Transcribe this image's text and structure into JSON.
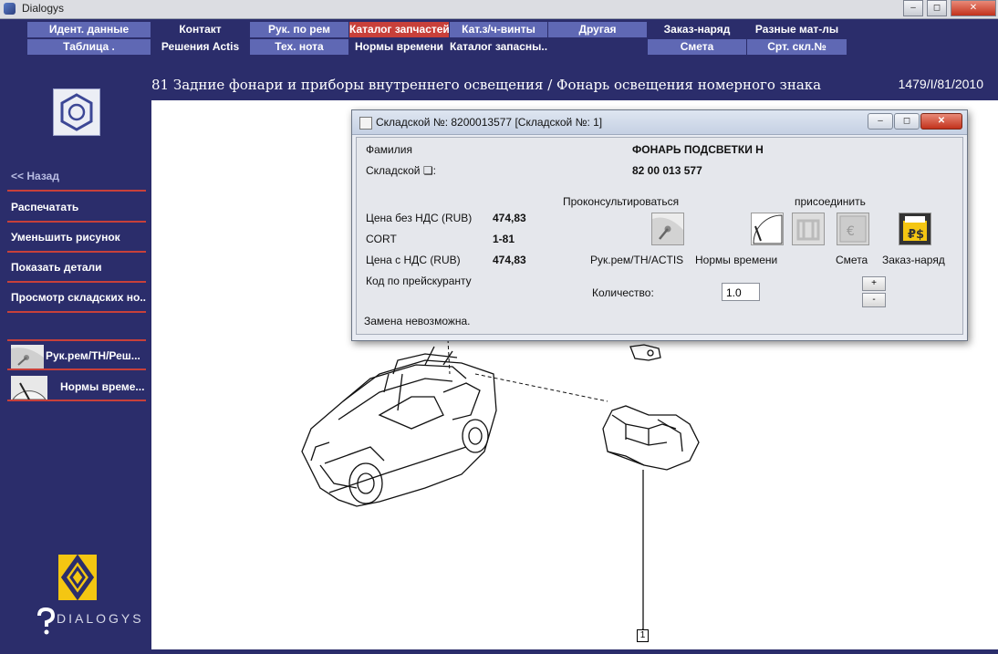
{
  "window": {
    "title": "Dialogys",
    "min": "–",
    "max": "◻",
    "close": "✕"
  },
  "menu": {
    "row1": [
      "Идент. данные",
      "Контакт",
      "Рук. по рем",
      "Каталог запчастей",
      "Кат.з/ч-винты",
      "Другая",
      "Заказ-наряд",
      "Разные мат-лы"
    ],
    "row2": [
      "Таблица .",
      "Решения Actis",
      "Тех. нота",
      "Нормы времени",
      "Каталог запасны...",
      "Смета",
      "Срт. скл.№"
    ]
  },
  "sidebar": {
    "back": "<< Назад",
    "items": [
      "Распечатать",
      "Уменьшить рисунок",
      "Показать детали",
      "Просмотр складских но..."
    ],
    "icon_items": [
      "Рук.рем/ТН/Реш...",
      "Нормы време..."
    ],
    "brand": "DIALOGYS"
  },
  "header": {
    "breadcrumb": "81 Задние фонари и приборы внутреннего освещения / Фонарь освещения номерного знака",
    "code": "1479/I/81/2010"
  },
  "dialog": {
    "title": "Складской №: 8200013577 [Складской №: 1]",
    "family_label": "Фамилия",
    "family_value": "ФОНАРЬ ПОДСВЕТКИ Н",
    "stock_label": "Складской ❏:",
    "stock_value": "82 00 013 577",
    "consult": "Проконсультироваться",
    "attach": "присоединить",
    "price_no_vat_label": "Цена без НДС (RUB)",
    "price_no_vat": "474,83",
    "cort_label": "CORT",
    "cort": "1-81",
    "price_vat_label": "Цена с НДС (RUB)",
    "price_vat": "474,83",
    "pricelist_label": "Код по прейскуранту",
    "icons": [
      "Рук.рем/ТН/ACTIS",
      "Нормы времени",
      "Смета",
      "Заказ-наряд"
    ],
    "qty_label": "Количество:",
    "qty_value": "1.0",
    "plus": "+",
    "minus": "-",
    "status": "Замена невозможна."
  },
  "diagram": {
    "callout": "1"
  }
}
